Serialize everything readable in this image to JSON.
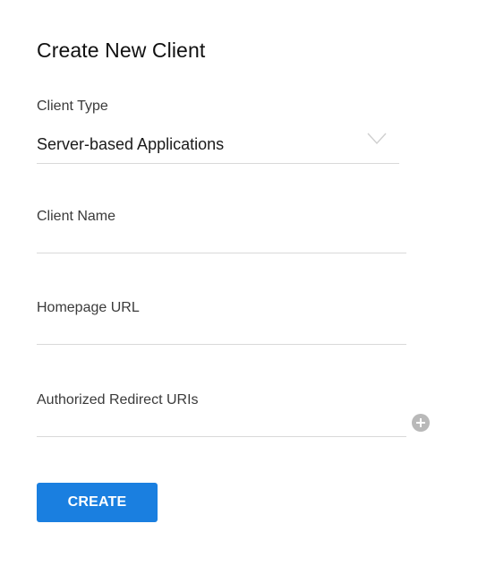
{
  "page": {
    "title": "Create New Client"
  },
  "fields": {
    "client_type": {
      "label": "Client Type",
      "value": "Server-based Applications"
    },
    "client_name": {
      "label": "Client Name",
      "value": ""
    },
    "homepage_url": {
      "label": "Homepage URL",
      "value": ""
    },
    "redirect_uris": {
      "label": "Authorized Redirect URIs",
      "value": ""
    }
  },
  "icons": {
    "dropdown": "chevron-down-icon",
    "add": "plus-circle-icon"
  },
  "actions": {
    "create_label": "CREATE"
  },
  "colors": {
    "primary": "#1a7fe0",
    "divider": "#d9d9d9",
    "add_icon": "#b9b9b9"
  }
}
